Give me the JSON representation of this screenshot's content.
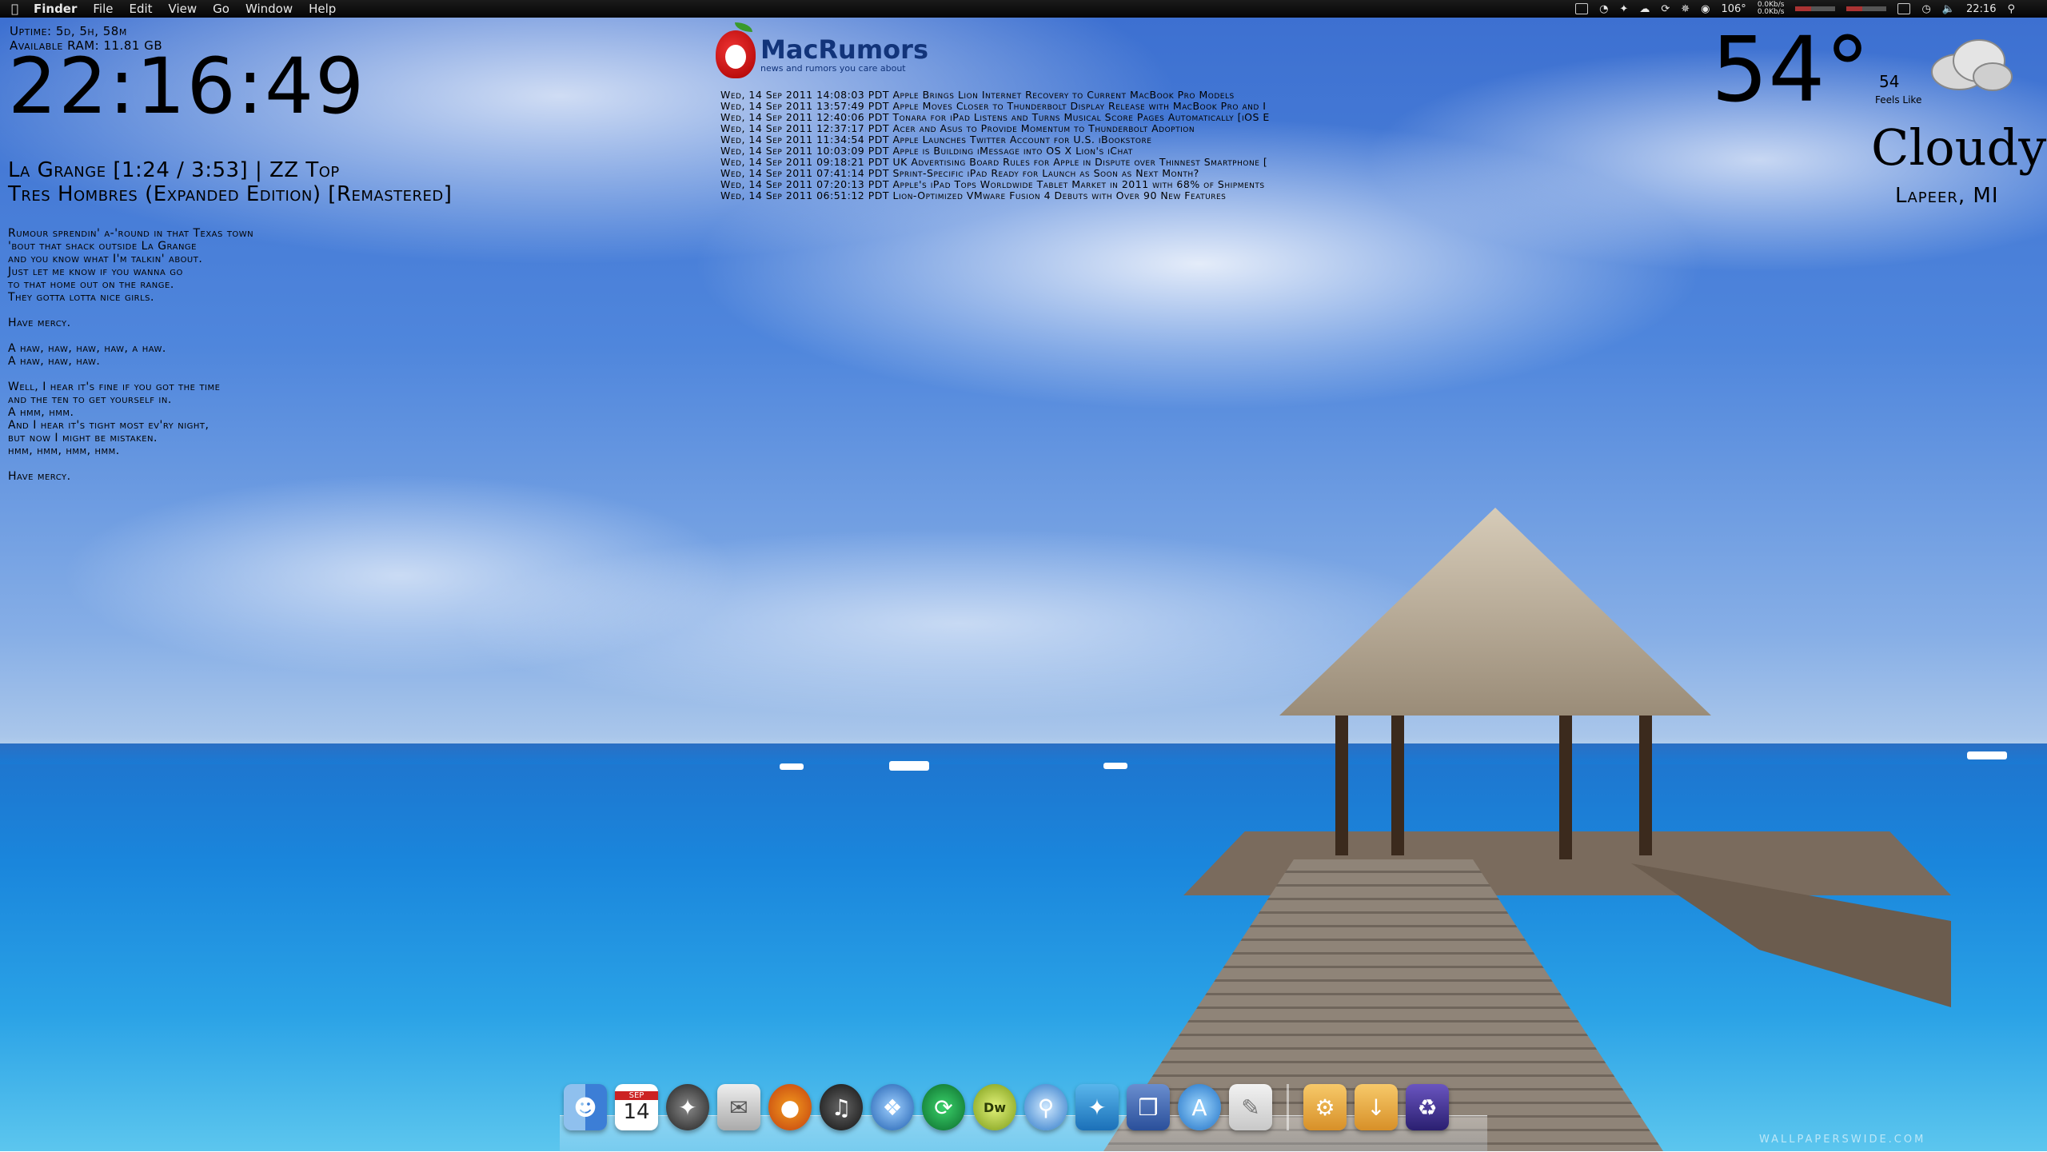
{
  "menubar": {
    "app": "Finder",
    "menus": [
      "File",
      "Edit",
      "View",
      "Go",
      "Window",
      "Help"
    ],
    "temp_status": "106°",
    "net_up": "0.0Kb/s",
    "net_down": "0.0Kb/s",
    "time": "22:16"
  },
  "sysinfo": {
    "uptime": "Uptime: 5d, 5h, 58m",
    "ram": "Available RAM: 11.81 GB"
  },
  "clock": {
    "time": "22:16:49"
  },
  "now_playing": {
    "line1": "La Grange [1:24 / 3:53] | ZZ Top",
    "line2": "Tres Hombres (Expanded Edition) [Remastered]"
  },
  "lyrics": "Rumour sprendin' a-'round in that Texas town\n'bout that shack outside La Grange\nand you know what I'm talkin' about.\nJust let me know if you wanna go\nto that home out on the range.\nThey gotta lotta nice girls.\n\nHave mercy.\n\nA haw, haw, haw, haw, a haw.\nA haw, haw, haw.\n\nWell, I hear it's fine if you got the time\nand the ten to get yourself in.\nA hmm, hmm.\nAnd I hear it's tight most ev'ry night,\nbut now I might be mistaken.\nhmm, hmm, hmm, hmm.\n\nHave mercy.",
  "macrumors": {
    "title": "MacRumors",
    "tagline": "news and rumors you care about",
    "headlines": [
      "Wed, 14 Sep 2011 14:08:03 PDT Apple Brings Lion Internet Recovery to Current MacBook Pro Models",
      "Wed, 14 Sep 2011 13:57:49 PDT Apple Moves Closer to Thunderbolt Display Release with MacBook Pro and I",
      "Wed, 14 Sep 2011 12:40:06 PDT Tonara for iPad Listens and Turns Musical Score Pages Automatically [iOS E",
      "Wed, 14 Sep 2011 12:37:17 PDT Acer and Asus to Provide Momentum to Thunderbolt Adoption",
      "Wed, 14 Sep 2011 11:34:54 PDT Apple Launches Twitter Account for U.S. iBookstore",
      "Wed, 14 Sep 2011 10:03:09 PDT Apple is Building iMessage into OS X Lion's iChat",
      "Wed, 14 Sep 2011 09:18:21 PDT UK Advertising Board Rules for Apple in Dispute over Thinnest Smartphone [",
      "Wed, 14 Sep 2011 07:41:14 PDT Sprint-Specific iPad Ready for Launch as Soon as Next Month?",
      "Wed, 14 Sep 2011 07:20:13 PDT Apple's iPad Tops Worldwide Tablet Market in 2011 with 68% of Shipments",
      "Wed, 14 Sep 2011 06:51:12 PDT Lion-Optimized VMware Fusion 4 Debuts with Over 90 New Features"
    ]
  },
  "weather": {
    "temp": "54°",
    "feels_like_value": "54",
    "feels_like_label": "Feels Like",
    "condition": "Cloudy",
    "location": "Lapeer, MI"
  },
  "dock": {
    "calendar_month": "SEP",
    "calendar_day": "14",
    "dw_label": "Dw"
  },
  "watermark": "WALLPAPERSWIDE.COM"
}
